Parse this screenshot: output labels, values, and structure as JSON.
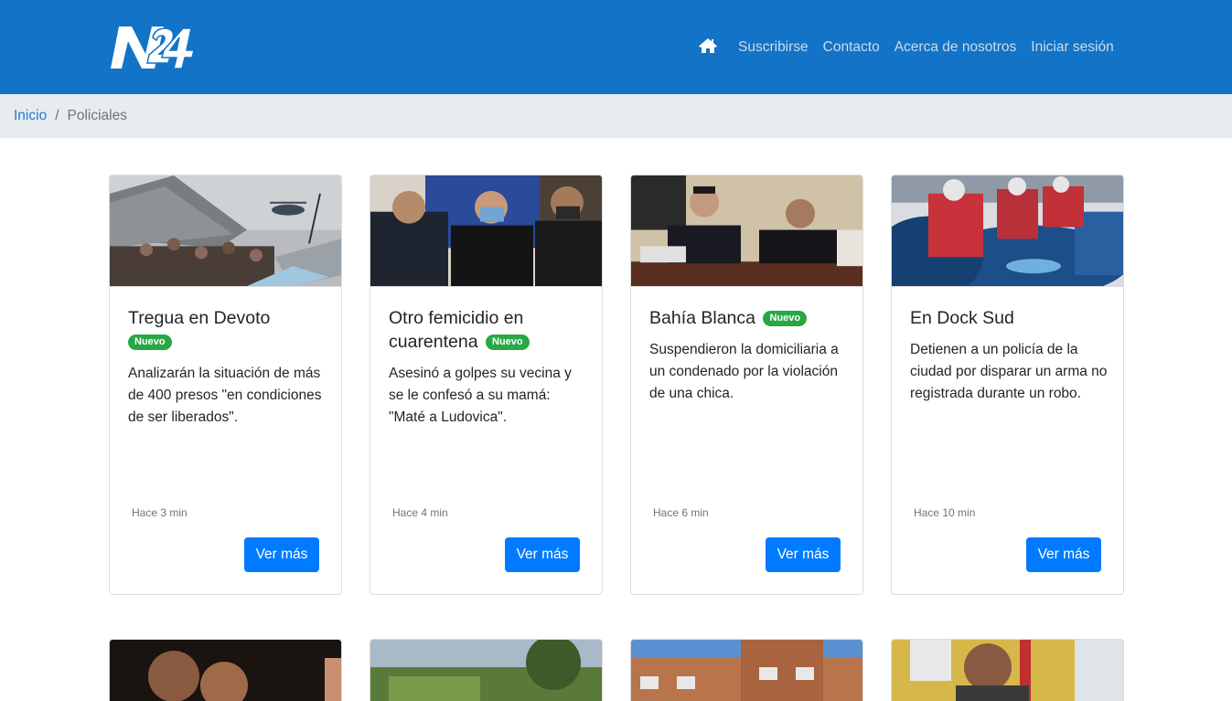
{
  "header": {
    "logo_text": "N24",
    "home_icon": "home-icon",
    "nav": [
      {
        "label": "Suscribirse"
      },
      {
        "label": "Contacto"
      },
      {
        "label": "Acerca de nosotros"
      },
      {
        "label": "Iniciar sesión"
      }
    ]
  },
  "breadcrumb": {
    "home": "Inicio",
    "separator": "/",
    "current": "Policiales"
  },
  "cards": [
    {
      "title": "Tregua en Devoto",
      "badge": "Nuevo",
      "text": "Analizarán la situación de más de 400 presos \"en condiciones de ser liberados\".",
      "time": "Hace 3 min",
      "button": "Ver más"
    },
    {
      "title": "Otro femicidio en cuarentena",
      "badge": "Nuevo",
      "text": "Asesinó a golpes su vecina y se le confesó a su mamá: \"Maté a Ludovica\".",
      "time": "Hace 4 min",
      "button": "Ver más"
    },
    {
      "title": "Bahía Blanca",
      "badge": "Nuevo",
      "text": "Suspendieron la domiciliaria a un condenado por la violación de una chica.",
      "time": "Hace 6 min",
      "button": "Ver más"
    },
    {
      "title": "En Dock Sud",
      "text": "Detienen a un policía de la ciudad por disparar un arma no registrada durante un robo.",
      "time": "Hace 10 min",
      "button": "Ver más"
    }
  ],
  "colors": {
    "navbar": "#1373c6",
    "badge": "#28a745",
    "button": "#007bff",
    "breadcrumb_bg": "#e9ecef"
  }
}
